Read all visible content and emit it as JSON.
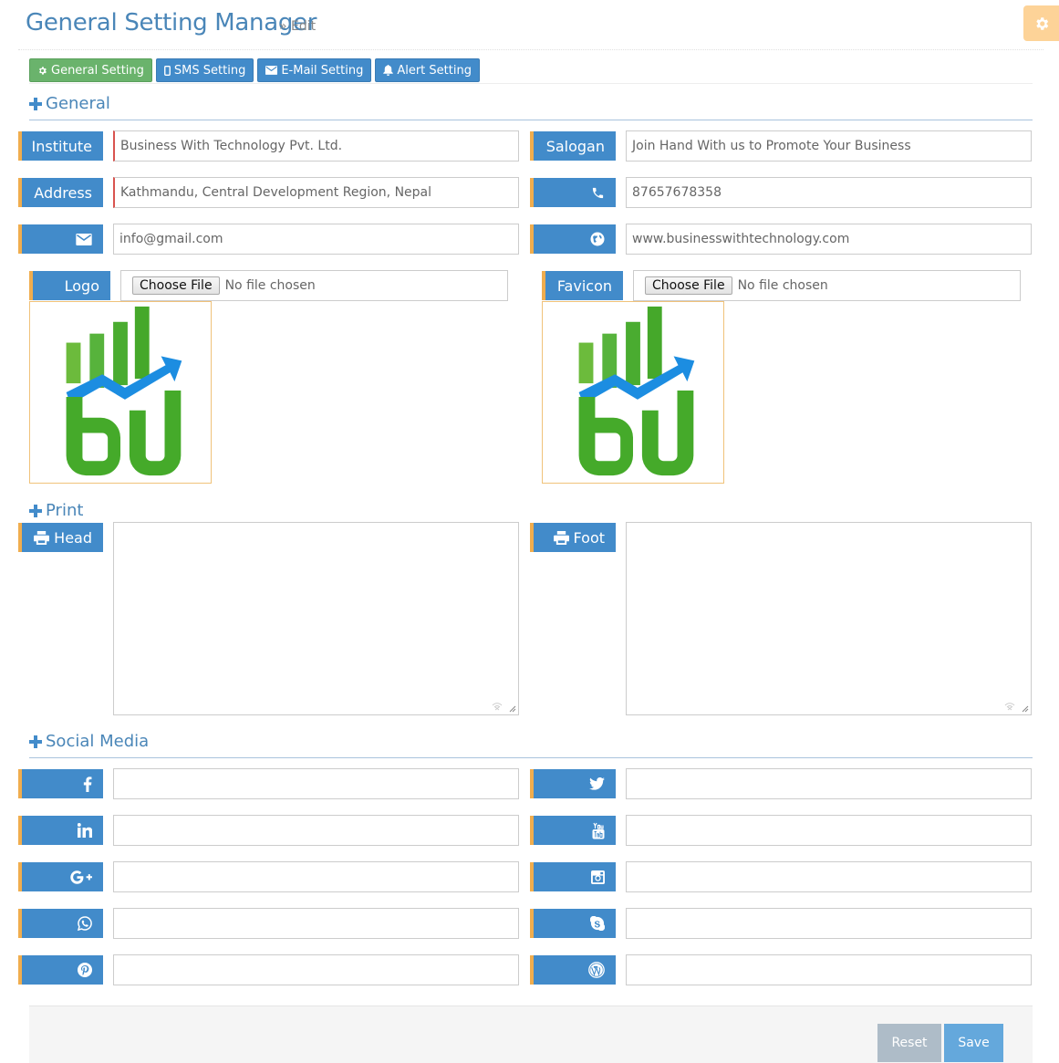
{
  "header": {
    "title": "General Setting Manager",
    "subtitle": "» Edit",
    "settings_icon": "gear-icon"
  },
  "tabs": [
    {
      "label": "General Setting",
      "icon": "gear-icon",
      "active": true
    },
    {
      "label": "SMS Setting",
      "icon": "mobile-icon",
      "active": false
    },
    {
      "label": "E-Mail Setting",
      "icon": "envelope-icon",
      "active": false
    },
    {
      "label": "Alert Setting",
      "icon": "bell-icon",
      "active": false
    }
  ],
  "sections": {
    "general": "General",
    "print": "Print",
    "social": "Social Media"
  },
  "general": {
    "institute_label": "Institute",
    "institute_value": "Business With Technology Pvt. Ltd.",
    "slogan_label": "Salogan",
    "slogan_value": "Join Hand With us to Promote Your Business",
    "address_label": "Address",
    "address_value": "Kathmandu, Central Development Region, Nepal",
    "phone_value": "87657678358",
    "email_value": "info@gmail.com",
    "website_value": "www.businesswithtechnology.com",
    "logo_label": "Logo",
    "favicon_label": "Favicon",
    "choose_file": "Choose File",
    "no_file": "No file chosen"
  },
  "print": {
    "head_label": "Head",
    "foot_label": "Foot"
  },
  "social": [
    {
      "icon": "facebook-icon",
      "value": ""
    },
    {
      "icon": "twitter-icon",
      "value": ""
    },
    {
      "icon": "linkedin-icon",
      "value": ""
    },
    {
      "icon": "youtube-icon",
      "value": ""
    },
    {
      "icon": "google-plus-icon",
      "value": ""
    },
    {
      "icon": "instagram-icon",
      "value": ""
    },
    {
      "icon": "whatsapp-icon",
      "value": ""
    },
    {
      "icon": "skype-icon",
      "value": ""
    },
    {
      "icon": "pinterest-icon",
      "value": ""
    },
    {
      "icon": "wordpress-icon",
      "value": ""
    }
  ],
  "footer": {
    "reset_label": "Reset",
    "save_label": "Save"
  },
  "colors": {
    "primary": "#428bca",
    "accent": "#f0ad4e",
    "active_tab": "#6ab36c",
    "title": "#4a86b8"
  }
}
